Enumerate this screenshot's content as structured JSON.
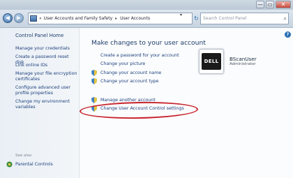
{
  "window": {
    "controls": [
      "—",
      "▭",
      "✕"
    ]
  },
  "addressbar": {
    "back_glyph": "◀",
    "forward_glyph": "▶",
    "breadcrumb_prefix": "«",
    "crumbs": [
      "User Accounts and Family Safety",
      "User Accounts"
    ],
    "crumb_separator": "▸",
    "dropdown_glyph": "▾",
    "refresh_glyph": "↻",
    "search_placeholder": "Search Control Panel",
    "search_glyph": "⌕"
  },
  "sidebar": {
    "home": "Control Panel Home",
    "links": [
      "Manage your credentials",
      "Create a password reset disk",
      "Link online IDs",
      "Manage your file encryption certificates",
      "Configure advanced user profile properties",
      "Change my environment variables"
    ],
    "see_also": "See also",
    "parental_controls": "Parental Controls"
  },
  "main": {
    "heading": "Make changes to your user account",
    "links": [
      "Create a password for your account",
      "Change your picture",
      "Change your account name",
      "Change your account type"
    ],
    "manage_another": "Manage another account",
    "uac_settings": "Change User Account Control settings",
    "help_glyph": "?"
  },
  "account": {
    "logo_text": "DELL",
    "name": "BScanUser",
    "role": "Administrator"
  },
  "colors": {
    "link": "#1c3f7c",
    "heading": "#1d3c6a",
    "highlight_ellipse": "#c8232c"
  }
}
